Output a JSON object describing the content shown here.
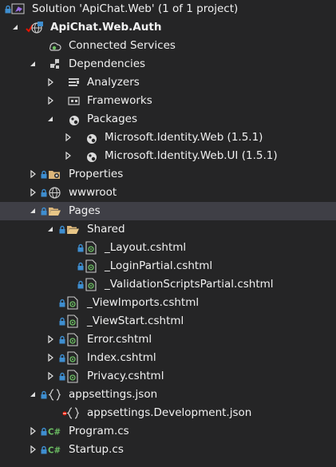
{
  "solution_explorer": {
    "nodes": [
      {
        "label": "Solution 'ApiChat.Web' (1 of 1 project)"
      },
      {
        "label": "ApiChat.Web.Auth"
      },
      {
        "label": "Connected Services"
      },
      {
        "label": "Dependencies"
      },
      {
        "label": "Analyzers"
      },
      {
        "label": "Frameworks"
      },
      {
        "label": "Packages"
      },
      {
        "label": "Microsoft.Identity.Web (1.5.1)"
      },
      {
        "label": "Microsoft.Identity.Web.UI (1.5.1)"
      },
      {
        "label": "Properties"
      },
      {
        "label": "wwwroot"
      },
      {
        "label": "Pages"
      },
      {
        "label": "Shared"
      },
      {
        "label": "_Layout.cshtml"
      },
      {
        "label": "_LoginPartial.cshtml"
      },
      {
        "label": "_ValidationScriptsPartial.cshtml"
      },
      {
        "label": "_ViewImports.cshtml"
      },
      {
        "label": "_ViewStart.cshtml"
      },
      {
        "label": "Error.cshtml"
      },
      {
        "label": "Index.cshtml"
      },
      {
        "label": "Privacy.cshtml"
      },
      {
        "label": "appsettings.json"
      },
      {
        "label": "appsettings.Development.json"
      },
      {
        "label": "Program.cs"
      },
      {
        "label": "Startup.cs"
      }
    ]
  },
  "colors": {
    "background": "#252526",
    "selected_row": "#3f3f46",
    "text": "#f1f1f1",
    "lock_blue": "#3e8ed0",
    "csharp_green": "#6dc064",
    "folder_yellow": "#dcb67a",
    "vs_purple": "#9b6ee3",
    "red_check": "#e51400"
  }
}
